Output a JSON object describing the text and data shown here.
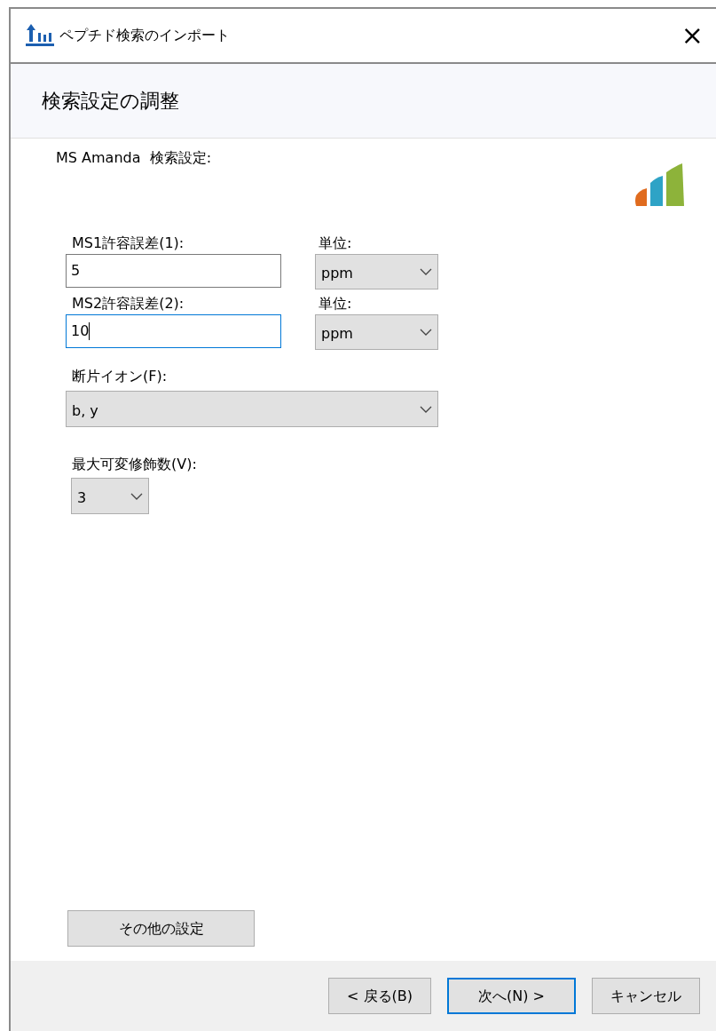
{
  "window": {
    "title": "ペプチド検索のインポート",
    "close": "×"
  },
  "header": {
    "title": "検索設定の調整"
  },
  "section_title": "MS Amanda  検索設定:",
  "ms1_tolerance": {
    "label": "MS1許容誤差(1):",
    "value": "5",
    "focused": false,
    "unit_label": "単位:",
    "unit": "ppm"
  },
  "ms2_tolerance": {
    "label": "MS2許容誤差(2):",
    "value": "10",
    "focused": true,
    "unit_label": "単位:",
    "unit": "ppm"
  },
  "fragment_ions": {
    "label": "断片イオン(F):",
    "value": "b, y"
  },
  "max_variable_mods": {
    "label": "最大可変修飾数(V):",
    "value": "3"
  },
  "more_settings_button": "その他の設定",
  "buttons": [
    {
      "label": "< 戻る(B)",
      "default": false
    },
    {
      "label": "次へ(N) >",
      "default": true
    },
    {
      "label": "キャンセル",
      "default": false
    }
  ]
}
